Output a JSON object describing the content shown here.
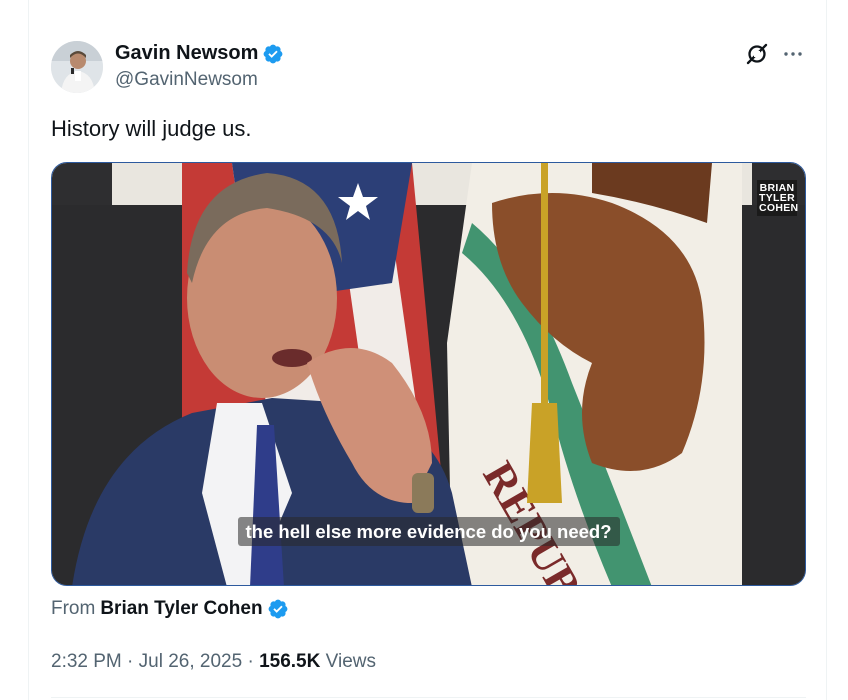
{
  "author": {
    "name": "Gavin Newsom",
    "handle": "@GavinNewsom",
    "verified": true
  },
  "tweet": {
    "text": "History will judge us."
  },
  "media": {
    "watermark_lines": [
      "BRIAN",
      "TYLER",
      "COHEN"
    ],
    "caption": "the hell else more evidence do you need?"
  },
  "source": {
    "prefix": "From",
    "name": "Brian Tyler Cohen",
    "verified": true
  },
  "meta": {
    "time": "2:32 PM",
    "separator": "·",
    "date": "Jul 26, 2025",
    "views_count": "156.5K",
    "views_label": "Views"
  },
  "colors": {
    "verified_blue": "#1d9bf0",
    "text_primary": "#0f1419",
    "text_secondary": "#536471",
    "media_border": "#2d5a9e"
  },
  "icons": [
    "avatar",
    "verified-badge-icon",
    "grok-icon",
    "more-icon"
  ]
}
